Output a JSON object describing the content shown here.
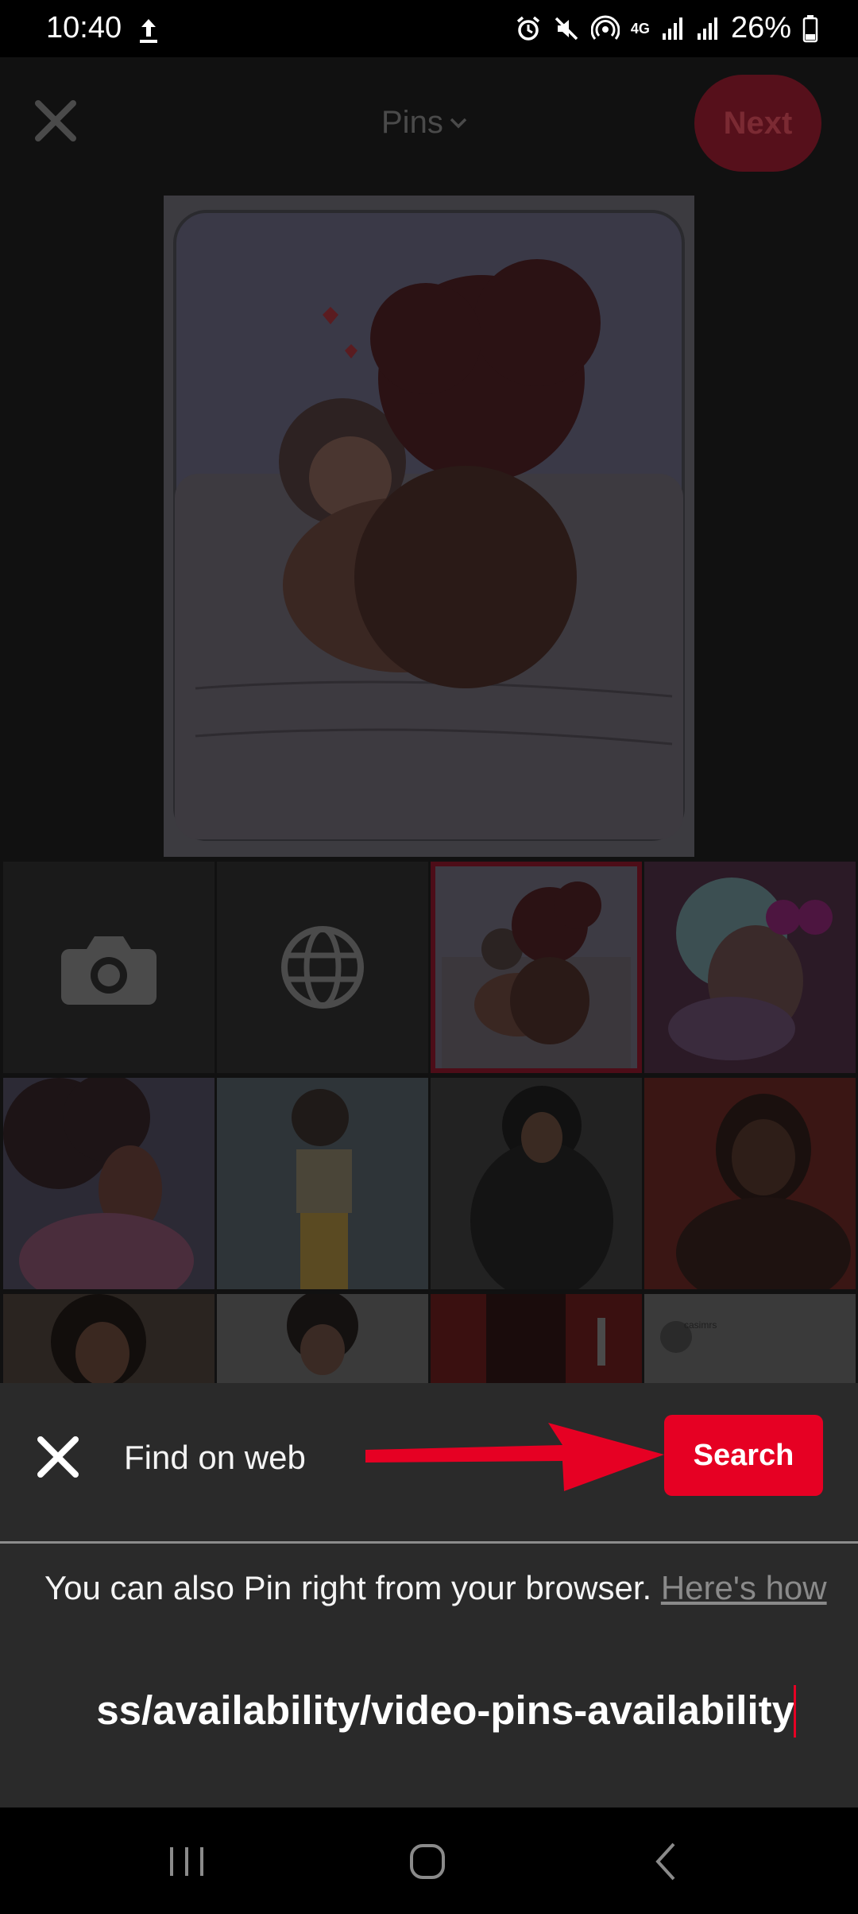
{
  "status_bar": {
    "time": "10:40",
    "network_label": "4G",
    "battery_percent": "26%"
  },
  "header": {
    "board_dropdown_label": "Pins",
    "next_label": "Next"
  },
  "grid": {
    "tiles": [
      "camera-tile",
      "web-tile",
      "selected-pin",
      "pin",
      "pin",
      "pin",
      "pin",
      "pin",
      "pin",
      "pin",
      "pin",
      "pin"
    ],
    "partial_tile_text": "casimrs"
  },
  "find_on_web": {
    "title": "Find on web",
    "search_label": "Search",
    "hint_text": "You can also Pin right from your browser. ",
    "hint_link": "Here's how",
    "url_value": "ss/availability/video-pins-availability"
  },
  "colors": {
    "accent": "#e60023",
    "sheet_background": "#2a2a2a",
    "dim_background": "#111111"
  },
  "icons": {
    "close": "close-icon",
    "camera": "camera-icon",
    "web": "globe-icon",
    "chevron": "chevron-down-icon",
    "arrow": "arrow-annotation"
  }
}
